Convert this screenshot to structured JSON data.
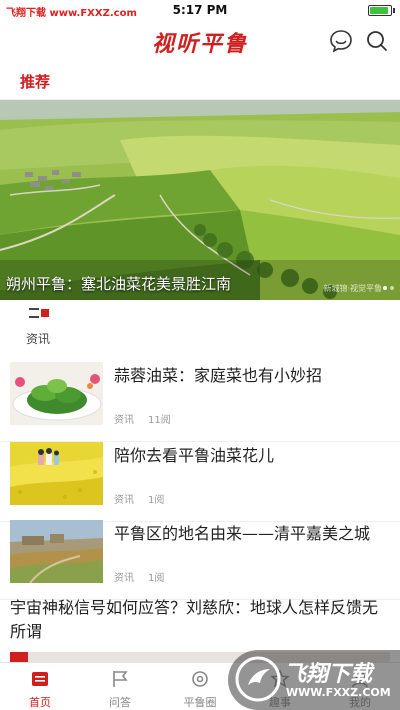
{
  "status_bar": {
    "watermark": "飞翔下载 www.FXXZ.com",
    "time": "5:17 PM",
    "battery_level": 0.9
  },
  "header": {
    "title": "视听平鲁",
    "icons": [
      "chat-icon",
      "search-icon"
    ]
  },
  "tabs": [
    {
      "label": "推荐",
      "active": true
    }
  ],
  "banner": {
    "caption": "朔州平鲁：塞北油菜花美景胜江南",
    "watermark": "新城锦·视觉平鲁",
    "dots": 2,
    "active_dot": 0
  },
  "section": {
    "label": "资讯"
  },
  "news": [
    {
      "title": "蒜蓉油菜：家庭菜也有小妙招",
      "category": "资讯",
      "count": "11阅"
    },
    {
      "title": "陪你去看平鲁油菜花儿",
      "category": "资讯",
      "count": "1阅"
    },
    {
      "title": "平鲁区的地名由来——清平嘉美之城",
      "category": "资讯",
      "count": "1阅"
    }
  ],
  "long_news": {
    "title": "宇宙神秘信号如何应答？刘慈欣：地球人怎样反馈无所谓"
  },
  "tabbar": [
    {
      "label": "首页",
      "icon": "home-icon",
      "active": true
    },
    {
      "label": "问答",
      "icon": "flag-icon",
      "active": false
    },
    {
      "label": "平鲁圈",
      "icon": "circle-icon",
      "active": false
    },
    {
      "label": "趣事",
      "icon": "star-icon",
      "active": false
    },
    {
      "label": "我的",
      "icon": "user-icon",
      "active": false
    }
  ],
  "corner_watermark": {
    "title": "飞翔下载",
    "url": "WWW.FXXZ.COM"
  },
  "colors": {
    "accent": "#d01f1f",
    "muted_text": "#999999",
    "tab_inactive": "#888888"
  }
}
